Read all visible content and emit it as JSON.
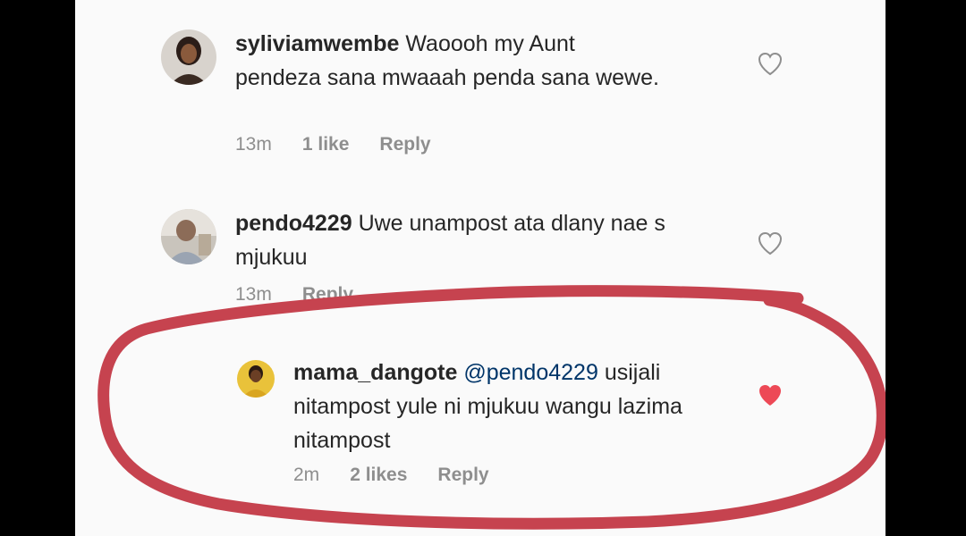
{
  "comments": [
    {
      "username": "syliviamwembe",
      "body": "Waoooh my Aunt pendeza sana mwaaah penda sana wewe.",
      "time": "13m",
      "likes": "1 like",
      "reply": "Reply",
      "liked": false
    },
    {
      "username": "pendo4229",
      "body": "Uwe unampost ata dlany nae s mjukuu",
      "time": "13m",
      "likes": "",
      "reply": "Reply",
      "liked": false
    },
    {
      "username": "mama_dangote",
      "mention": "@pendo4229",
      "body": "usijali nitampost yule ni mjukuu wangu lazima nitampost",
      "time": "2m",
      "likes": "2 likes",
      "reply": "Reply",
      "liked": true
    }
  ],
  "colors": {
    "heart_liked": "#ed4956",
    "mention": "#003569",
    "highlight_stroke": "#c6434f"
  }
}
